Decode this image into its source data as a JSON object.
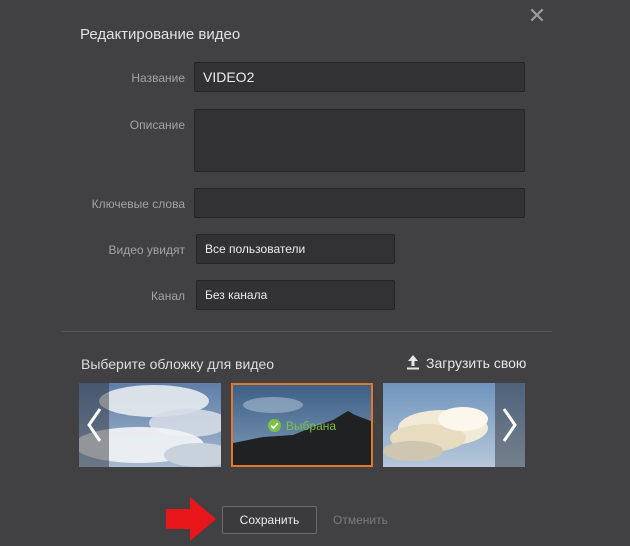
{
  "dialog": {
    "title": "Редактирование видео",
    "close_icon": "close-icon"
  },
  "form": {
    "name_label": "Название",
    "name_value": "VIDEO2",
    "description_label": "Описание",
    "description_value": "",
    "keywords_label": "Ключевые слова",
    "keywords_value": "",
    "visibility_label": "Видео увидят",
    "visibility_value": "Все пользователи",
    "channel_label": "Канал",
    "channel_value": "Без канала"
  },
  "cover": {
    "title": "Выберите обложку для видео",
    "upload_label": "Загрузить свою",
    "upload_icon": "upload-icon",
    "selected_label": "Выбрана",
    "selected_index": 1
  },
  "actions": {
    "save_label": "Сохранить",
    "cancel_label": "Отменить"
  },
  "colors": {
    "background": "#414143",
    "selected_border": "#e2782c",
    "selected_text": "#7bc143",
    "pointer_arrow": "#e8161b"
  }
}
